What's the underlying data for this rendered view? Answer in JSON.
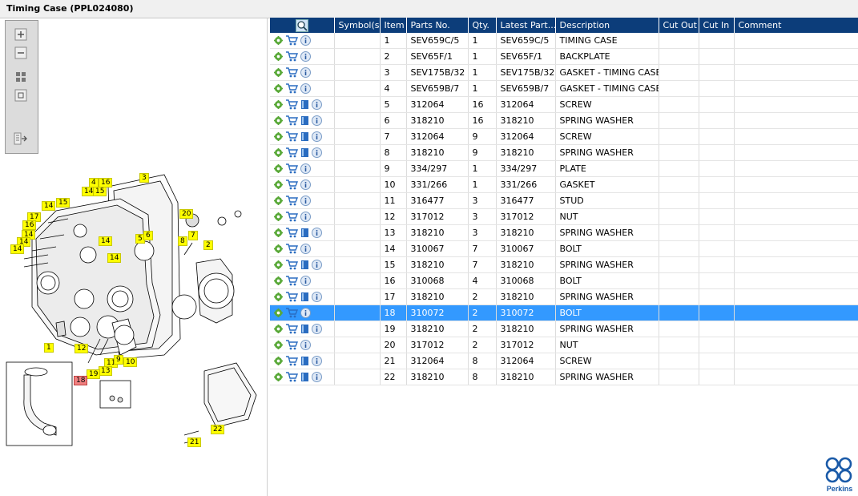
{
  "title": "Timing Case (PPL024080)",
  "columns": [
    "Symbol(s)",
    "Item",
    "Parts No.",
    "Qty.",
    "Latest Part...",
    "Description",
    "Cut Out",
    "Cut In",
    "Comment"
  ],
  "rows": [
    {
      "item": "1",
      "part": "SEV659C/5",
      "qty": "1",
      "latest": "SEV659C/5",
      "desc": "TIMING CASE",
      "book": false
    },
    {
      "item": "2",
      "part": "SEV65F/1",
      "qty": "1",
      "latest": "SEV65F/1",
      "desc": "BACKPLATE",
      "book": false
    },
    {
      "item": "3",
      "part": "SEV175B/32",
      "qty": "1",
      "latest": "SEV175B/32",
      "desc": "GASKET - TIMING CASE",
      "book": false
    },
    {
      "item": "4",
      "part": "SEV659B/7",
      "qty": "1",
      "latest": "SEV659B/7",
      "desc": "GASKET - TIMING CASE",
      "book": false
    },
    {
      "item": "5",
      "part": "312064",
      "qty": "16",
      "latest": "312064",
      "desc": "SCREW",
      "book": true
    },
    {
      "item": "6",
      "part": "318210",
      "qty": "16",
      "latest": "318210",
      "desc": "SPRING WASHER",
      "book": true
    },
    {
      "item": "7",
      "part": "312064",
      "qty": "9",
      "latest": "312064",
      "desc": "SCREW",
      "book": true
    },
    {
      "item": "8",
      "part": "318210",
      "qty": "9",
      "latest": "318210",
      "desc": "SPRING WASHER",
      "book": true
    },
    {
      "item": "9",
      "part": "334/297",
      "qty": "1",
      "latest": "334/297",
      "desc": "PLATE",
      "book": false
    },
    {
      "item": "10",
      "part": "331/266",
      "qty": "1",
      "latest": "331/266",
      "desc": "GASKET",
      "book": false
    },
    {
      "item": "11",
      "part": "316477",
      "qty": "3",
      "latest": "316477",
      "desc": "STUD",
      "book": false
    },
    {
      "item": "12",
      "part": "317012",
      "qty": "3",
      "latest": "317012",
      "desc": "NUT",
      "book": false
    },
    {
      "item": "13",
      "part": "318210",
      "qty": "3",
      "latest": "318210",
      "desc": "SPRING WASHER",
      "book": true
    },
    {
      "item": "14",
      "part": "310067",
      "qty": "7",
      "latest": "310067",
      "desc": "BOLT",
      "book": false
    },
    {
      "item": "15",
      "part": "318210",
      "qty": "7",
      "latest": "318210",
      "desc": "SPRING WASHER",
      "book": true
    },
    {
      "item": "16",
      "part": "310068",
      "qty": "4",
      "latest": "310068",
      "desc": "BOLT",
      "book": false
    },
    {
      "item": "17",
      "part": "318210",
      "qty": "2",
      "latest": "318210",
      "desc": "SPRING WASHER",
      "book": true
    },
    {
      "item": "18",
      "part": "310072",
      "qty": "2",
      "latest": "310072",
      "desc": "BOLT",
      "book": false,
      "selected": true
    },
    {
      "item": "19",
      "part": "318210",
      "qty": "2",
      "latest": "318210",
      "desc": "SPRING WASHER",
      "book": true
    },
    {
      "item": "20",
      "part": "317012",
      "qty": "2",
      "latest": "317012",
      "desc": "NUT",
      "book": false
    },
    {
      "item": "21",
      "part": "312064",
      "qty": "8",
      "latest": "312064",
      "desc": "SCREW",
      "book": true
    },
    {
      "item": "22",
      "part": "318210",
      "qty": "8",
      "latest": "318210",
      "desc": "SPRING WASHER",
      "book": true
    }
  ],
  "callouts": [
    {
      "label": "3"
    },
    {
      "label": "4"
    },
    {
      "label": "16"
    },
    {
      "label": "14"
    },
    {
      "label": "15"
    },
    {
      "label": "15"
    },
    {
      "label": "14"
    },
    {
      "label": "17"
    },
    {
      "label": "16"
    },
    {
      "label": "14"
    },
    {
      "label": "14"
    },
    {
      "label": "14"
    },
    {
      "label": "20"
    },
    {
      "label": "5"
    },
    {
      "label": "6"
    },
    {
      "label": "7"
    },
    {
      "label": "8"
    },
    {
      "label": "2"
    },
    {
      "label": "14"
    },
    {
      "label": "14"
    },
    {
      "label": "1"
    },
    {
      "label": "12"
    },
    {
      "label": "11"
    },
    {
      "label": "9"
    },
    {
      "label": "10"
    },
    {
      "label": "13"
    },
    {
      "label": "19"
    },
    {
      "label": "18"
    },
    {
      "label": "21"
    },
    {
      "label": "22"
    }
  ],
  "logo_text": "Perkins",
  "colors": {
    "header": "#0c3d7a",
    "selected": "#3399ff",
    "callout": "#ffff00",
    "logo": "#1a5aa8"
  }
}
